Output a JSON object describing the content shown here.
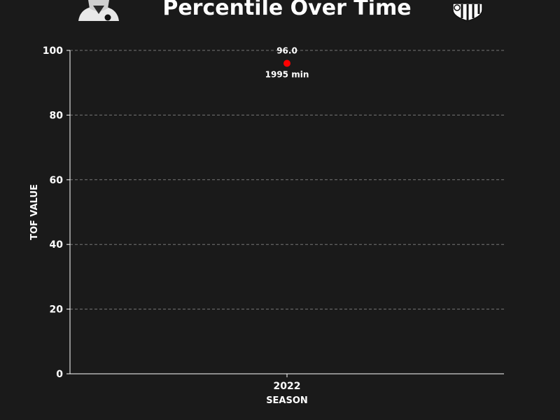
{
  "chart_data": {
    "type": "scatter",
    "title": "Percentile Over Time",
    "xlabel": "SEASON",
    "ylabel": "TOF VALUE",
    "categories": [
      "2022"
    ],
    "ylim": [
      0,
      100
    ],
    "yticks": [
      0,
      20,
      40,
      60,
      80,
      100
    ],
    "grid": true,
    "series": [
      {
        "color": "#ff0000",
        "points": [
          {
            "x": "2022",
            "y": 96.0,
            "value_label": "96.0",
            "minutes_label": "1995 min"
          }
        ]
      }
    ]
  },
  "colors": {
    "background": "#1a1a1a",
    "text": "#ffffff",
    "point": "#ff0000",
    "grid": "#777777"
  },
  "icons": {
    "left": "player-avatar-icon",
    "right": "club-crest-icon"
  }
}
